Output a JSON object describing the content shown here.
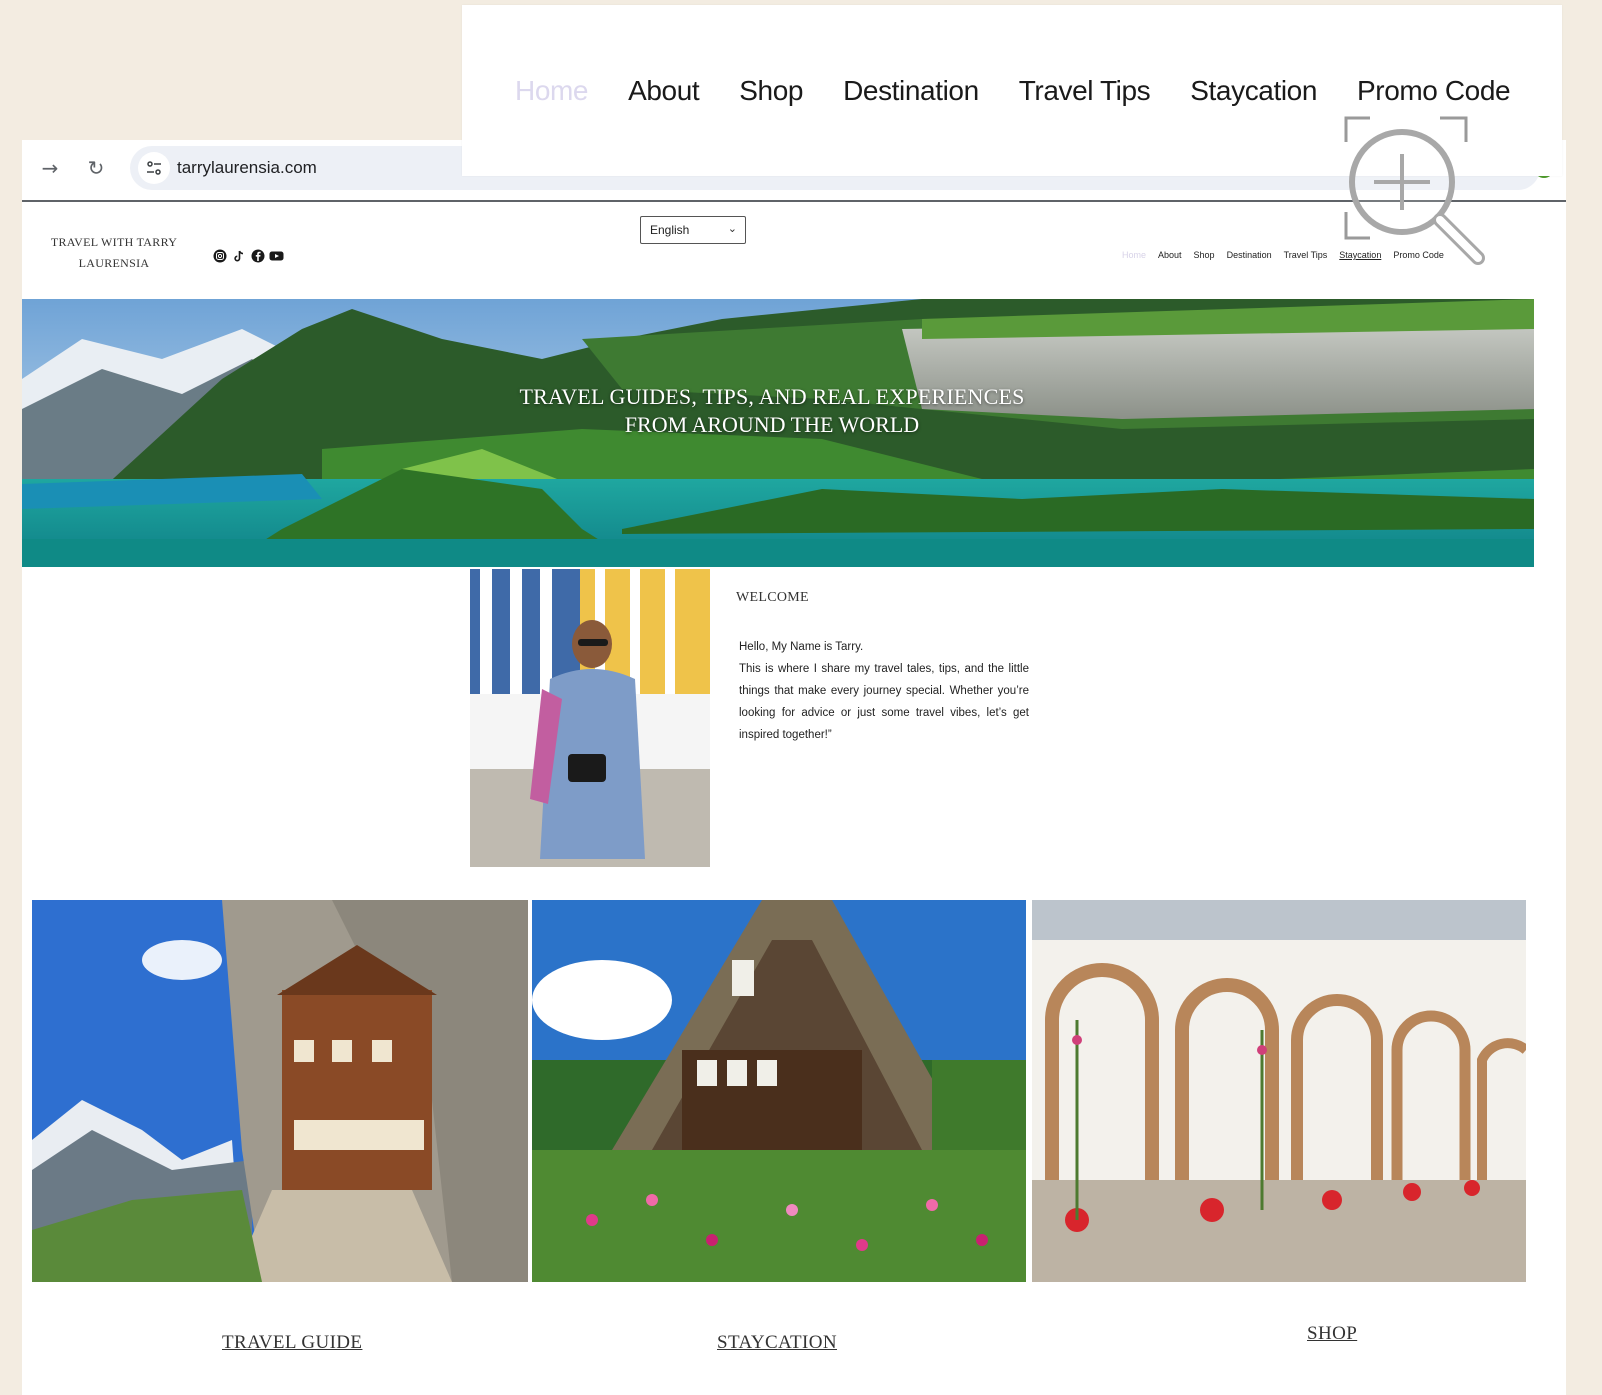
{
  "browser": {
    "url": "tarrylaurensia.com"
  },
  "site": {
    "brand": "TRAVEL WITH TARRY LAURENSIA",
    "socials": [
      "instagram-icon",
      "tiktok-icon",
      "facebook-icon",
      "youtube-icon"
    ],
    "language": "English",
    "nav": [
      "Home",
      "About",
      "Shop",
      "Destination",
      "Travel Tips",
      "Staycation",
      "Promo Code"
    ],
    "active_nav": "Home"
  },
  "zoom_nav": {
    "items": [
      "Home",
      "About",
      "Shop",
      "Destination",
      "Travel Tips",
      "Staycation",
      "Promo Code"
    ]
  },
  "hero": {
    "line1": "TRAVEL GUIDES, TIPS, AND REAL EXPERIENCES",
    "line2": "FROM AROUND THE WORLD"
  },
  "welcome": {
    "heading": "WELCOME",
    "greeting": "Hello, My Name is Tarry.",
    "body": "This is where I share my travel tales, tips, and the little things that make every journey special. Whether you’re looking for advice or just some travel vibes, let’s get inspired together!”"
  },
  "gallery": {
    "captions": [
      "TRAVEL GUIDE",
      "STAYCATION",
      "SHOP"
    ]
  },
  "colors": {
    "page_bg": "#f3ece1",
    "active_nav": "#dcd8ee",
    "lake": "#1aa39a"
  }
}
